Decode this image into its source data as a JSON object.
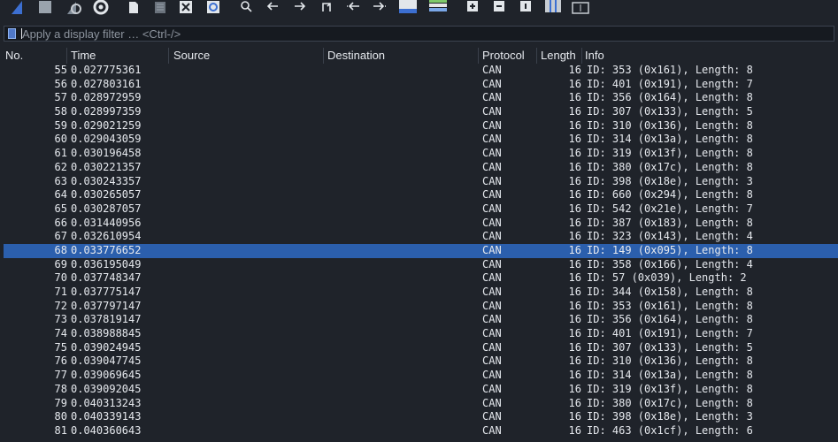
{
  "toolbar": {
    "icons": [
      "shark-fin-start-icon",
      "stop-icon",
      "restart-icon",
      "capture-options-icon",
      "open-file-icon",
      "save-file-icon",
      "close-file-icon",
      "reload-icon",
      "find-icon",
      "go-back-icon",
      "go-forward-icon",
      "go-to-packet-icon",
      "go-first-icon",
      "go-last-icon",
      "autoscroll-icon",
      "colorize-icon",
      "zoom-in-icon",
      "zoom-out-icon",
      "normal-size-icon",
      "resize-columns-icon",
      "expand-icon"
    ]
  },
  "filter": {
    "placeholder": "Apply a display filter … <Ctrl-/>",
    "value": ""
  },
  "columns": {
    "no": "No.",
    "time": "Time",
    "source": "Source",
    "destination": "Destination",
    "protocol": "Protocol",
    "length": "Length",
    "info": "Info"
  },
  "selected_row": 68,
  "colors": {
    "background": "#1f232a",
    "selection": "#2b5fad",
    "text": "#e6e9ee"
  },
  "packets": [
    {
      "no": "55",
      "time": "0.027775361",
      "src": "",
      "dst": "",
      "proto": "CAN",
      "len": "16",
      "info": "ID: 353 (0x161), Length: 8"
    },
    {
      "no": "56",
      "time": "0.027803161",
      "src": "",
      "dst": "",
      "proto": "CAN",
      "len": "16",
      "info": "ID: 401 (0x191), Length: 7"
    },
    {
      "no": "57",
      "time": "0.028972959",
      "src": "",
      "dst": "",
      "proto": "CAN",
      "len": "16",
      "info": "ID: 356 (0x164), Length: 8"
    },
    {
      "no": "58",
      "time": "0.028997359",
      "src": "",
      "dst": "",
      "proto": "CAN",
      "len": "16",
      "info": "ID: 307 (0x133), Length: 5"
    },
    {
      "no": "59",
      "time": "0.029021259",
      "src": "",
      "dst": "",
      "proto": "CAN",
      "len": "16",
      "info": "ID: 310 (0x136), Length: 8"
    },
    {
      "no": "60",
      "time": "0.029043059",
      "src": "",
      "dst": "",
      "proto": "CAN",
      "len": "16",
      "info": "ID: 314 (0x13a), Length: 8"
    },
    {
      "no": "61",
      "time": "0.030196458",
      "src": "",
      "dst": "",
      "proto": "CAN",
      "len": "16",
      "info": "ID: 319 (0x13f), Length: 8"
    },
    {
      "no": "62",
      "time": "0.030221357",
      "src": "",
      "dst": "",
      "proto": "CAN",
      "len": "16",
      "info": "ID: 380 (0x17c), Length: 8"
    },
    {
      "no": "63",
      "time": "0.030243357",
      "src": "",
      "dst": "",
      "proto": "CAN",
      "len": "16",
      "info": "ID: 398 (0x18e), Length: 3"
    },
    {
      "no": "64",
      "time": "0.030265057",
      "src": "",
      "dst": "",
      "proto": "CAN",
      "len": "16",
      "info": "ID: 660 (0x294), Length: 8"
    },
    {
      "no": "65",
      "time": "0.030287057",
      "src": "",
      "dst": "",
      "proto": "CAN",
      "len": "16",
      "info": "ID: 542 (0x21e), Length: 7"
    },
    {
      "no": "66",
      "time": "0.031440956",
      "src": "",
      "dst": "",
      "proto": "CAN",
      "len": "16",
      "info": "ID: 387 (0x183), Length: 8"
    },
    {
      "no": "67",
      "time": "0.032610954",
      "src": "",
      "dst": "",
      "proto": "CAN",
      "len": "16",
      "info": "ID: 323 (0x143), Length: 4"
    },
    {
      "no": "68",
      "time": "0.033776652",
      "src": "",
      "dst": "",
      "proto": "CAN",
      "len": "16",
      "info": "ID: 149 (0x095), Length: 8"
    },
    {
      "no": "69",
      "time": "0.036195049",
      "src": "",
      "dst": "",
      "proto": "CAN",
      "len": "16",
      "info": "ID: 358 (0x166), Length: 4"
    },
    {
      "no": "70",
      "time": "0.037748347",
      "src": "",
      "dst": "",
      "proto": "CAN",
      "len": "16",
      "info": "ID: 57 (0x039), Length: 2"
    },
    {
      "no": "71",
      "time": "0.037775147",
      "src": "",
      "dst": "",
      "proto": "CAN",
      "len": "16",
      "info": "ID: 344 (0x158), Length: 8"
    },
    {
      "no": "72",
      "time": "0.037797147",
      "src": "",
      "dst": "",
      "proto": "CAN",
      "len": "16",
      "info": "ID: 353 (0x161), Length: 8"
    },
    {
      "no": "73",
      "time": "0.037819147",
      "src": "",
      "dst": "",
      "proto": "CAN",
      "len": "16",
      "info": "ID: 356 (0x164), Length: 8"
    },
    {
      "no": "74",
      "time": "0.038988845",
      "src": "",
      "dst": "",
      "proto": "CAN",
      "len": "16",
      "info": "ID: 401 (0x191), Length: 7"
    },
    {
      "no": "75",
      "time": "0.039024945",
      "src": "",
      "dst": "",
      "proto": "CAN",
      "len": "16",
      "info": "ID: 307 (0x133), Length: 5"
    },
    {
      "no": "76",
      "time": "0.039047745",
      "src": "",
      "dst": "",
      "proto": "CAN",
      "len": "16",
      "info": "ID: 310 (0x136), Length: 8"
    },
    {
      "no": "77",
      "time": "0.039069645",
      "src": "",
      "dst": "",
      "proto": "CAN",
      "len": "16",
      "info": "ID: 314 (0x13a), Length: 8"
    },
    {
      "no": "78",
      "time": "0.039092045",
      "src": "",
      "dst": "",
      "proto": "CAN",
      "len": "16",
      "info": "ID: 319 (0x13f), Length: 8"
    },
    {
      "no": "79",
      "time": "0.040313243",
      "src": "",
      "dst": "",
      "proto": "CAN",
      "len": "16",
      "info": "ID: 380 (0x17c), Length: 8"
    },
    {
      "no": "80",
      "time": "0.040339143",
      "src": "",
      "dst": "",
      "proto": "CAN",
      "len": "16",
      "info": "ID: 398 (0x18e), Length: 3"
    },
    {
      "no": "81",
      "time": "0.040360643",
      "src": "",
      "dst": "",
      "proto": "CAN",
      "len": "16",
      "info": "ID: 463 (0x1cf), Length: 6"
    }
  ]
}
